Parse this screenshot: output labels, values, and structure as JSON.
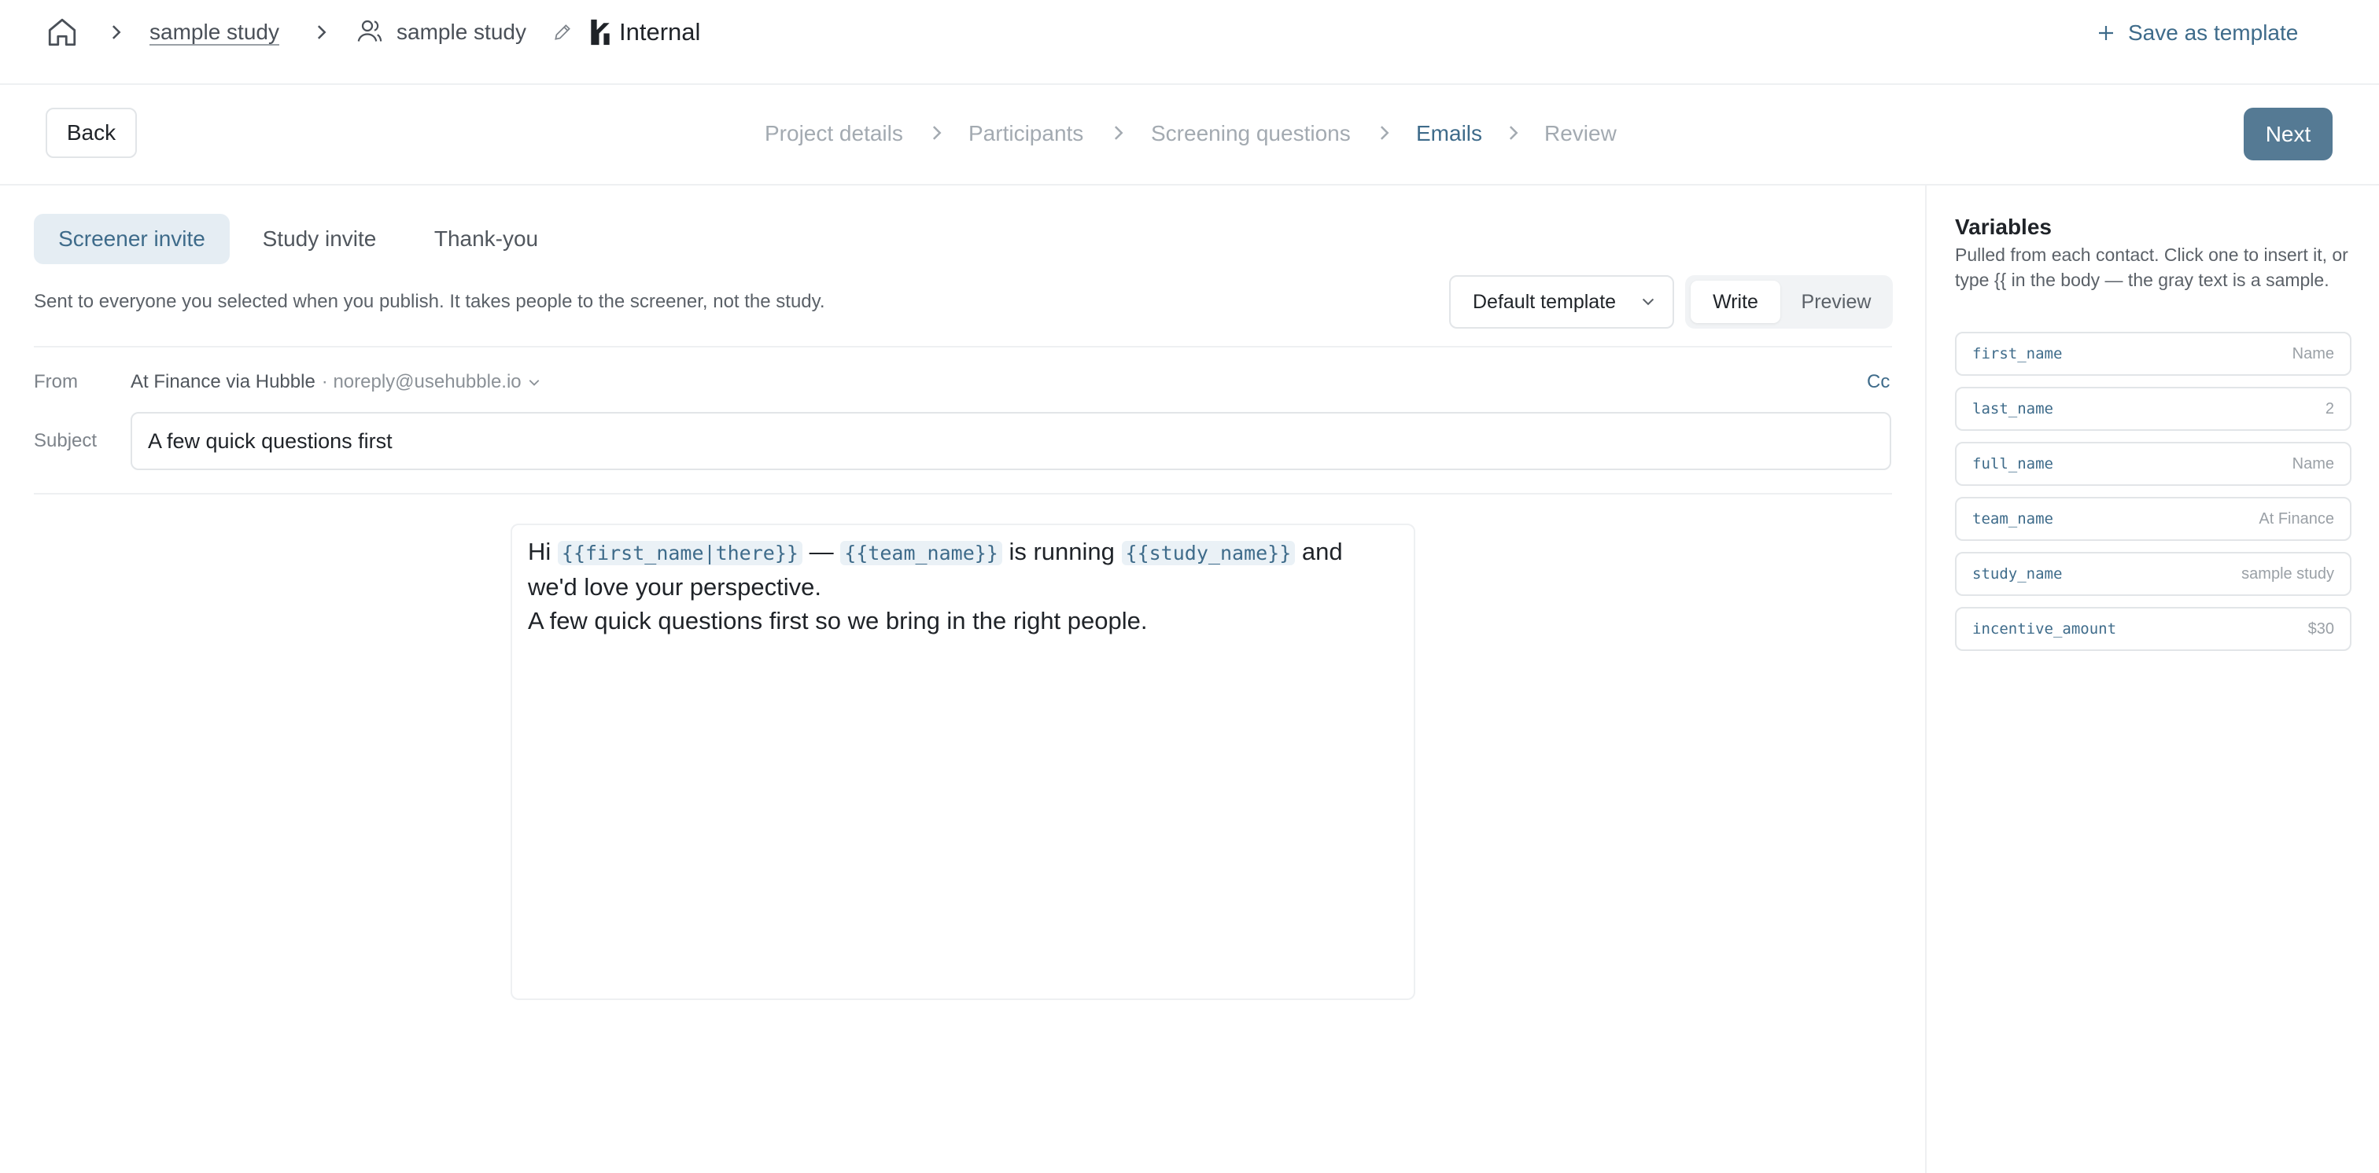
{
  "breadcrumb": {
    "project": "sample study",
    "study": "sample study",
    "workspace": "Internal"
  },
  "header": {
    "save_template": "Save as template"
  },
  "nav": {
    "back": "Back",
    "next": "Next",
    "steps": [
      "Project details",
      "Participants",
      "Screening questions",
      "Emails",
      "Review"
    ],
    "active_step": "Emails"
  },
  "tabs": [
    "Screener invite",
    "Study invite",
    "Thank-you"
  ],
  "active_tab": "Screener invite",
  "description": "Sent to everyone you selected when you publish. It takes people to the screener, not the study.",
  "template_select": {
    "value": "Default template"
  },
  "mode": {
    "write": "Write",
    "preview": "Preview",
    "active": "Write"
  },
  "email": {
    "from_label": "From",
    "from_name": "At Finance via Hubble",
    "from_email": "· noreply@usehubble.io",
    "cc": "Cc",
    "subject_label": "Subject",
    "subject": "A few quick questions first",
    "body": {
      "greeting": "Hi",
      "var1": "{{first_name|there}}",
      "dash": "—",
      "var2": "{{team_name}}",
      "running": "is running",
      "var3": "{{study_name}}",
      "and": "and",
      "line1_end": "we'd love your perspective.",
      "line2": "A few quick questions first so we bring in the right people."
    }
  },
  "variables": {
    "title": "Variables",
    "description": "Pulled from each contact. Click one to insert it, or type {{ in the body — the gray text is a sample.",
    "items": [
      {
        "name": "first_name",
        "sample": "Name"
      },
      {
        "name": "last_name",
        "sample": "2"
      },
      {
        "name": "full_name",
        "sample": "Name"
      },
      {
        "name": "team_name",
        "sample": "At Finance"
      },
      {
        "name": "study_name",
        "sample": "sample study"
      },
      {
        "name": "incentive_amount",
        "sample": "$30"
      }
    ]
  },
  "colors": {
    "accent": "#3e6b8a",
    "next_button": "#557a94",
    "active_tab_bg": "#e5edf3",
    "chip_bg": "#eaf1f6"
  }
}
